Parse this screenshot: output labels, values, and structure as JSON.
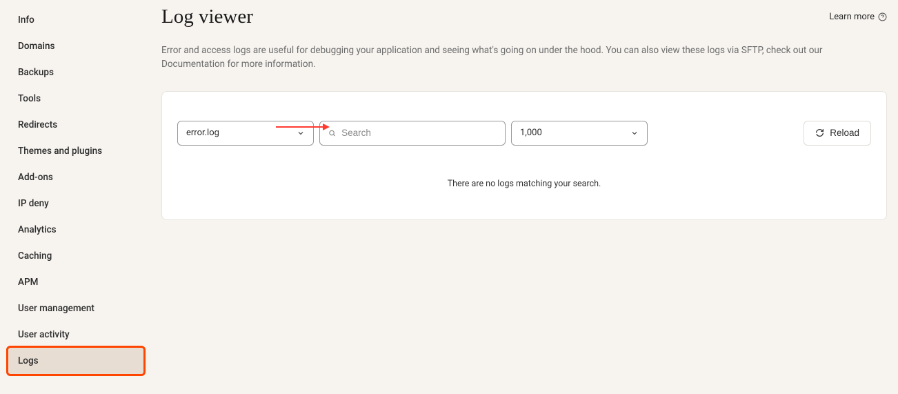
{
  "sidebar": {
    "items": [
      {
        "label": "Info"
      },
      {
        "label": "Domains"
      },
      {
        "label": "Backups"
      },
      {
        "label": "Tools"
      },
      {
        "label": "Redirects"
      },
      {
        "label": "Themes and plugins"
      },
      {
        "label": "Add-ons"
      },
      {
        "label": "IP deny"
      },
      {
        "label": "Analytics"
      },
      {
        "label": "Caching"
      },
      {
        "label": "APM"
      },
      {
        "label": "User management"
      },
      {
        "label": "User activity"
      },
      {
        "label": "Logs",
        "active": true
      }
    ]
  },
  "header": {
    "title": "Log viewer",
    "learn_more": "Learn more"
  },
  "description": "Error and access logs are useful for debugging your application and seeing what's going on under the hood. You can also view these logs via SFTP, check out our Documentation for more information.",
  "controls": {
    "log_select": "error.log",
    "search_placeholder": "Search",
    "limit_select": "1,000",
    "reload_label": "Reload"
  },
  "empty_message": "There are no logs matching your search."
}
